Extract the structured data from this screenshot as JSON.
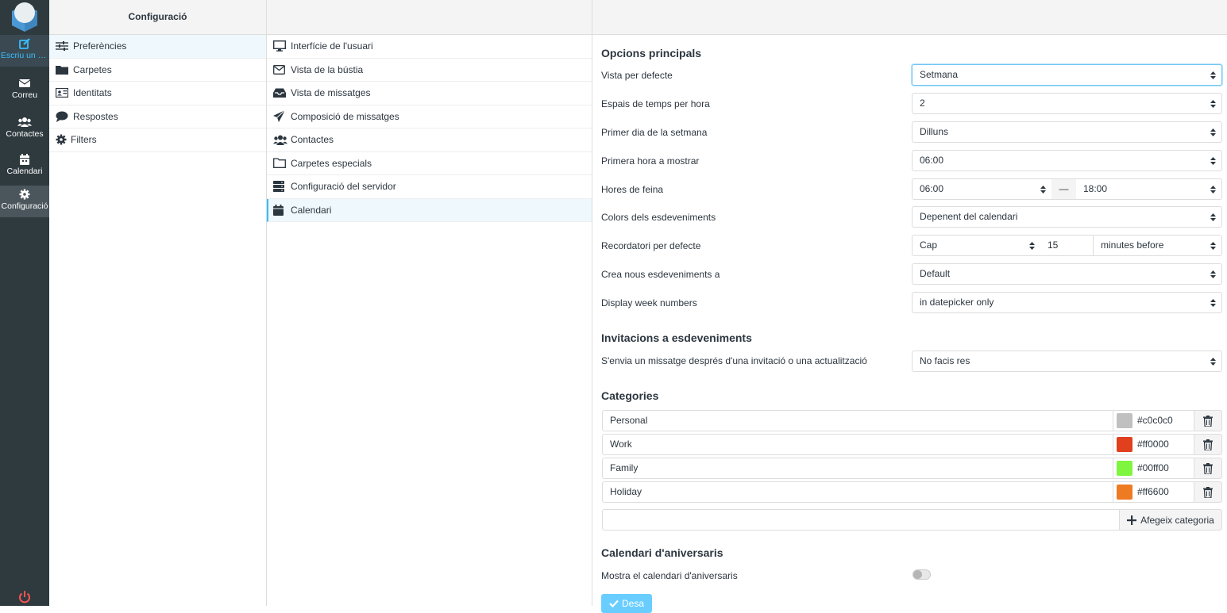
{
  "taskmenu": {
    "items": [
      {
        "label": "Escriu un m...",
        "icon": "compose-icon"
      },
      {
        "label": "Correu",
        "icon": "mail-icon"
      },
      {
        "label": "Contactes",
        "icon": "contacts-icon"
      },
      {
        "label": "Calendari",
        "icon": "calendar-icon"
      },
      {
        "label": "Configuració",
        "icon": "gear-icon"
      }
    ]
  },
  "settings_tabs": {
    "title": "Configuració",
    "items": [
      {
        "label": "Preferències",
        "icon": "sliders-icon"
      },
      {
        "label": "Carpetes",
        "icon": "folder-icon"
      },
      {
        "label": "Identitats",
        "icon": "id-card-icon"
      },
      {
        "label": "Respostes",
        "icon": "comment-icon"
      },
      {
        "label": "Filters",
        "icon": "gear-icon"
      }
    ]
  },
  "sections": {
    "items": [
      {
        "label": "Interfície de l'usuari",
        "icon": "monitor-icon"
      },
      {
        "label": "Vista de la bústia",
        "icon": "envelope-icon"
      },
      {
        "label": "Vista de missatges",
        "icon": "inbox-icon"
      },
      {
        "label": "Composició de missatges",
        "icon": "paper-plane-icon"
      },
      {
        "label": "Contactes",
        "icon": "users-icon"
      },
      {
        "label": "Carpetes especials",
        "icon": "folder-outline-icon"
      },
      {
        "label": "Configuració del servidor",
        "icon": "server-icon"
      },
      {
        "label": "Calendari",
        "icon": "calendar-icon"
      }
    ]
  },
  "main": {
    "main_options": {
      "heading": "Opcions principals",
      "default_view": {
        "label": "Vista per defecte",
        "value": "Setmana"
      },
      "time_slots": {
        "label": "Espais de temps per hora",
        "value": "2"
      },
      "first_day": {
        "label": "Primer dia de la setmana",
        "value": "Dilluns"
      },
      "first_hour": {
        "label": "Primera hora a mostrar",
        "value": "06:00"
      },
      "work_hours": {
        "label": "Hores de feina",
        "start": "06:00",
        "sep": "—",
        "end": "18:00"
      },
      "event_colors": {
        "label": "Colors dels esdeveniments",
        "value": "Depenent del calendari"
      },
      "default_alarm": {
        "label": "Recordatori per defecte",
        "type": "Cap",
        "offset": "15",
        "unit": "minutes before"
      },
      "new_events": {
        "label": "Crea nous esdeveniments a",
        "value": "Default"
      },
      "week_numbers": {
        "label": "Display week numbers",
        "value": "in datepicker only"
      }
    },
    "invitations": {
      "heading": "Invitacions a esdeveniments",
      "send_after": {
        "label": "S'envia un missatge després d'una invitació o una actualització",
        "value": "No facis res"
      }
    },
    "categories": {
      "heading": "Categories",
      "items": [
        {
          "name": "Personal",
          "color": "#c0c0c0",
          "swatch": "#c0c0c0"
        },
        {
          "name": "Work",
          "color": "#ff0000",
          "swatch": "#e0401e"
        },
        {
          "name": "Family",
          "color": "#00ff00",
          "swatch": "#7ff53f"
        },
        {
          "name": "Holiday",
          "color": "#ff6600",
          "swatch": "#ee7a22"
        }
      ],
      "add_label": "Afegeix categoria"
    },
    "birthdays": {
      "heading": "Calendari d'aniversaris",
      "show": {
        "label": "Mostra el calendari d'aniversaris",
        "enabled": false
      }
    },
    "save_label": "Desa"
  },
  "colors": {
    "accent": "#37beff",
    "logout": "#ff5552"
  }
}
